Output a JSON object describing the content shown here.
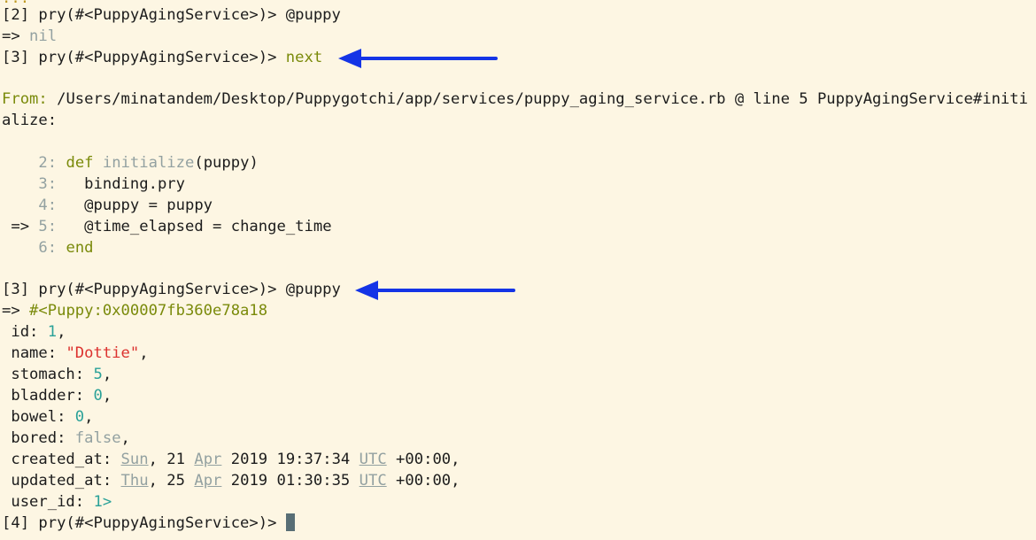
{
  "terminal": {
    "clipped_top": "...",
    "lines": [
      {
        "prompt": "[2] pry(#<PuppyAgingService>)> ",
        "cmd": "@puppy"
      },
      {
        "ret": "=> ",
        "val": "nil"
      },
      {
        "prompt": "[3] pry(#<PuppyAgingService>)> ",
        "cmd": "next"
      }
    ],
    "from": {
      "label": "From: ",
      "path": "/Users/minatandem/Desktop/Puppygotchi/app/services/puppy_aging_service.rb @ line 5 PuppyAgingService#initi",
      "path_cont": "alize:"
    },
    "code": [
      {
        "marker": "    ",
        "lineno": "2:",
        "text_kw": "def ",
        "text_fn": "initialize",
        "text_rest": "(puppy)"
      },
      {
        "marker": "    ",
        "lineno": "3:",
        "text": "  binding.pry"
      },
      {
        "marker": "    ",
        "lineno": "4:",
        "text": "  @puppy = puppy"
      },
      {
        "marker": " => ",
        "lineno": "5:",
        "text": "  @time_elapsed = change_time"
      },
      {
        "marker": "    ",
        "lineno": "6:",
        "text_kw": "end"
      }
    ],
    "prompt2": {
      "prompt": "[3] pry(#<PuppyAgingService>)> ",
      "cmd": "@puppy"
    },
    "result": {
      "ret": "=> ",
      "obj": "#<Puppy:0x00007fb360e78a18",
      "fields": {
        "id_key": " id: ",
        "id_val": "1",
        "name_key": " name: ",
        "name_val": "\"Dottie\"",
        "stomach_key": " stomach: ",
        "stomach_val": "5",
        "bladder_key": " bladder: ",
        "bladder_val": "0",
        "bowel_key": " bowel: ",
        "bowel_val": "0",
        "bored_key": " bored: ",
        "bored_val": "false",
        "created_key": " created_at: ",
        "created_day": "Sun",
        "created_d": "21",
        "created_mon": "Apr",
        "created_rest": "2019 19:37:34",
        "created_tz": "UTC",
        "created_off": "+00:00",
        "updated_key": " updated_at: ",
        "updated_day": "Thu",
        "updated_d": "25",
        "updated_mon": "Apr",
        "updated_rest": "2019 01:30:35",
        "updated_tz": "UTC",
        "updated_off": "+00:00",
        "user_key": " user_id: ",
        "user_val": "1>"
      }
    },
    "final_prompt": "[4] pry(#<PuppyAgingService>)> "
  },
  "colors": {
    "arrow": "#1434e6",
    "background": "#fdf6e3"
  }
}
